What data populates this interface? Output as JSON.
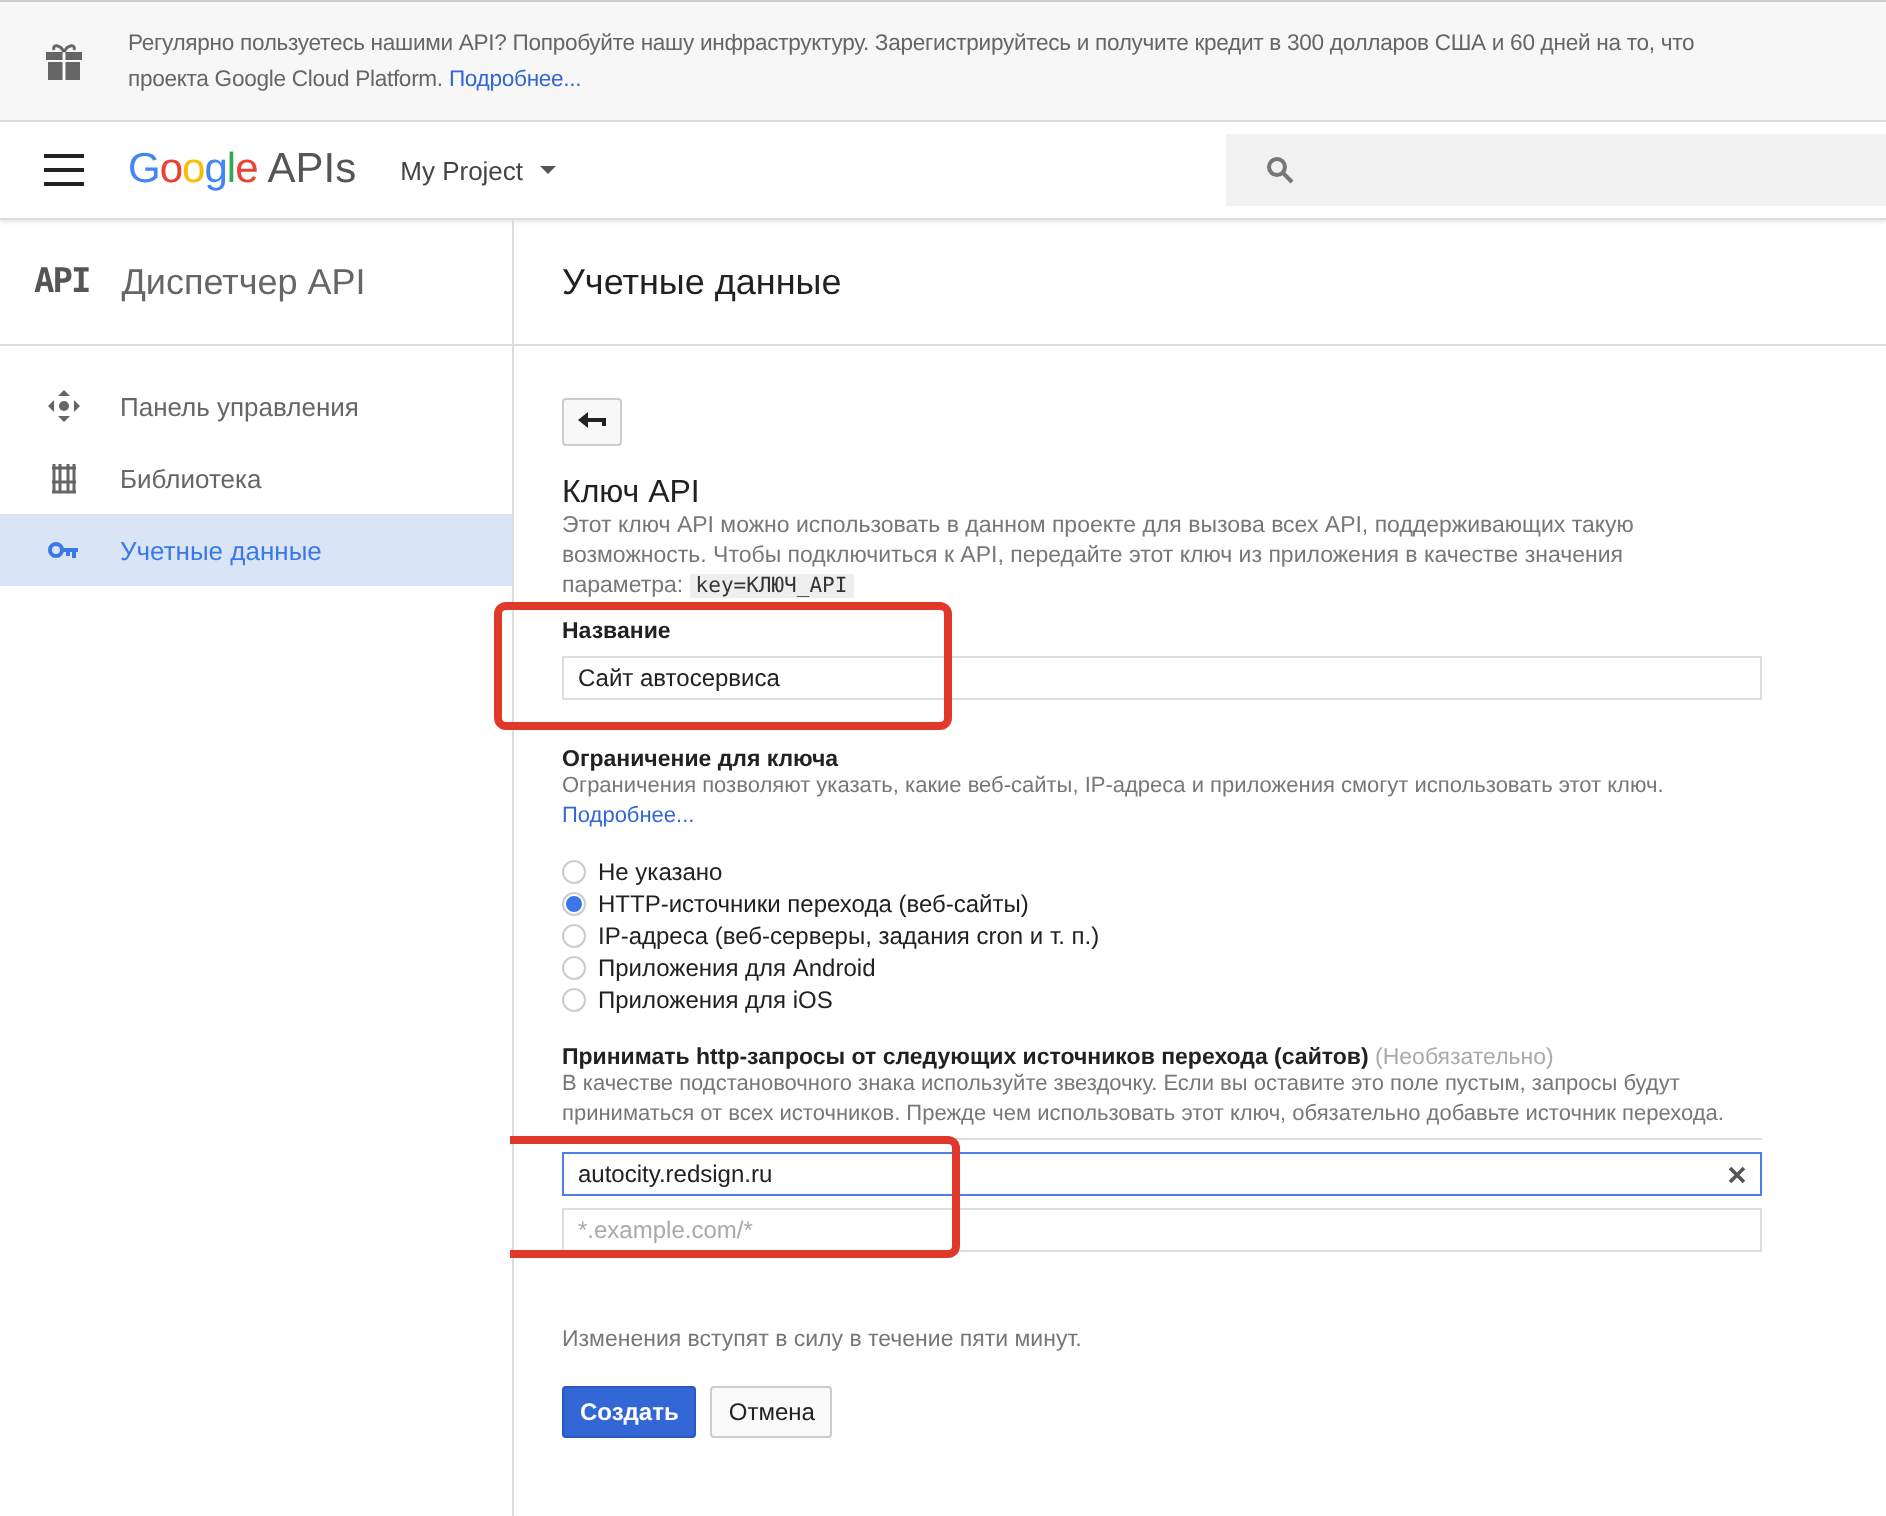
{
  "banner": {
    "text": "Регулярно пользуетесь нашими API? Попробуйте нашу инфраструктуру. Зарегистрируйтесь и получите кредит в 300 долларов США и 60 дней на то, что",
    "text2": "проекта Google Cloud Platform.",
    "link": "Подробнее..."
  },
  "header": {
    "logo_word": "Google",
    "logo_suffix": "APIs",
    "project": "My Project"
  },
  "sidebar": {
    "badge": "API",
    "title": "Диспетчер API",
    "items": [
      {
        "label": "Панель управления",
        "selected": false
      },
      {
        "label": "Библиотека",
        "selected": false
      },
      {
        "label": "Учетные данные",
        "selected": true
      }
    ]
  },
  "page": {
    "title": "Учетные данные"
  },
  "form": {
    "heading": "Ключ API",
    "intro": "Этот ключ API можно использовать в данном проекте для вызова всех API, поддерживающих такую возможность. Чтобы подключиться к API, передайте этот ключ из приложения в качестве значения параметра:",
    "intro_code": "key=КЛЮЧ_API",
    "name_label": "Название",
    "name_value": "Сайт автосервиса",
    "restriction_label": "Ограничение для ключа",
    "restriction_help": "Ограничения позволяют указать, какие веб-сайты, IP-адреса и приложения смогут использовать этот ключ.",
    "restriction_link": "Подробнее...",
    "options": [
      {
        "label": "Не указано",
        "selected": false
      },
      {
        "label": "HTTP-источники перехода (веб-сайты)",
        "selected": true
      },
      {
        "label": "IP-адреса (веб-серверы, задания cron и т. п.)",
        "selected": false
      },
      {
        "label": "Приложения для Android",
        "selected": false
      },
      {
        "label": "Приложения для iOS",
        "selected": false
      }
    ],
    "referrers_label": "Принимать http-запросы от следующих источников перехода (сайтов)",
    "referrers_optional": "(Необязательно)",
    "referrers_help": "В качестве подстановочного знака используйте звездочку. Если вы оставите это поле пустым, запросы будут приниматься от всех источников. Прежде чем использовать этот ключ, обязательно добавьте источник перехода.",
    "referrers": [
      {
        "value": "autocity.redsign.ru"
      },
      {
        "placeholder": "*.example.com/*"
      }
    ],
    "note": "Изменения вступят в силу в течение пяти минут.",
    "buttons": [
      {
        "label": "Создать",
        "kind": "primary"
      },
      {
        "label": "Отмена",
        "kind": "secondary"
      }
    ]
  }
}
